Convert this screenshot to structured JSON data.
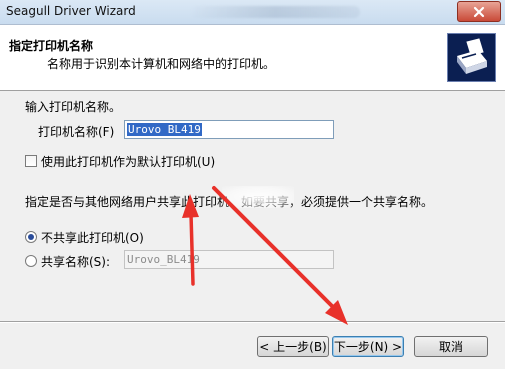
{
  "window": {
    "title": "Seagull Driver Wizard"
  },
  "header": {
    "title": "指定打印机名称",
    "subtitle": "名称用于识别本计算机和网络中的打印机。"
  },
  "form": {
    "prompt": "输入打印机名称。",
    "printer_name_label": "打印机名称(F)",
    "printer_name_value": "Urovo BL419",
    "default_checkbox_label": "使用此打印机作为默认打印机(U)",
    "default_checked": false,
    "share_prompt": "指定是否与其他网络用户共享此打印机。如要共享，必须提供一个共享名称。",
    "no_share_label": "不共享此打印机(O)",
    "share_label": "共享名称(S):",
    "share_name_value": "Urovo_BL419",
    "selected_option": "no_share"
  },
  "buttons": {
    "back": "< 上一步(B)",
    "next": "下一步(N) >",
    "cancel": "取消"
  },
  "colors": {
    "annotation_arrow": "#e8312a",
    "selection": "#3169c6"
  }
}
